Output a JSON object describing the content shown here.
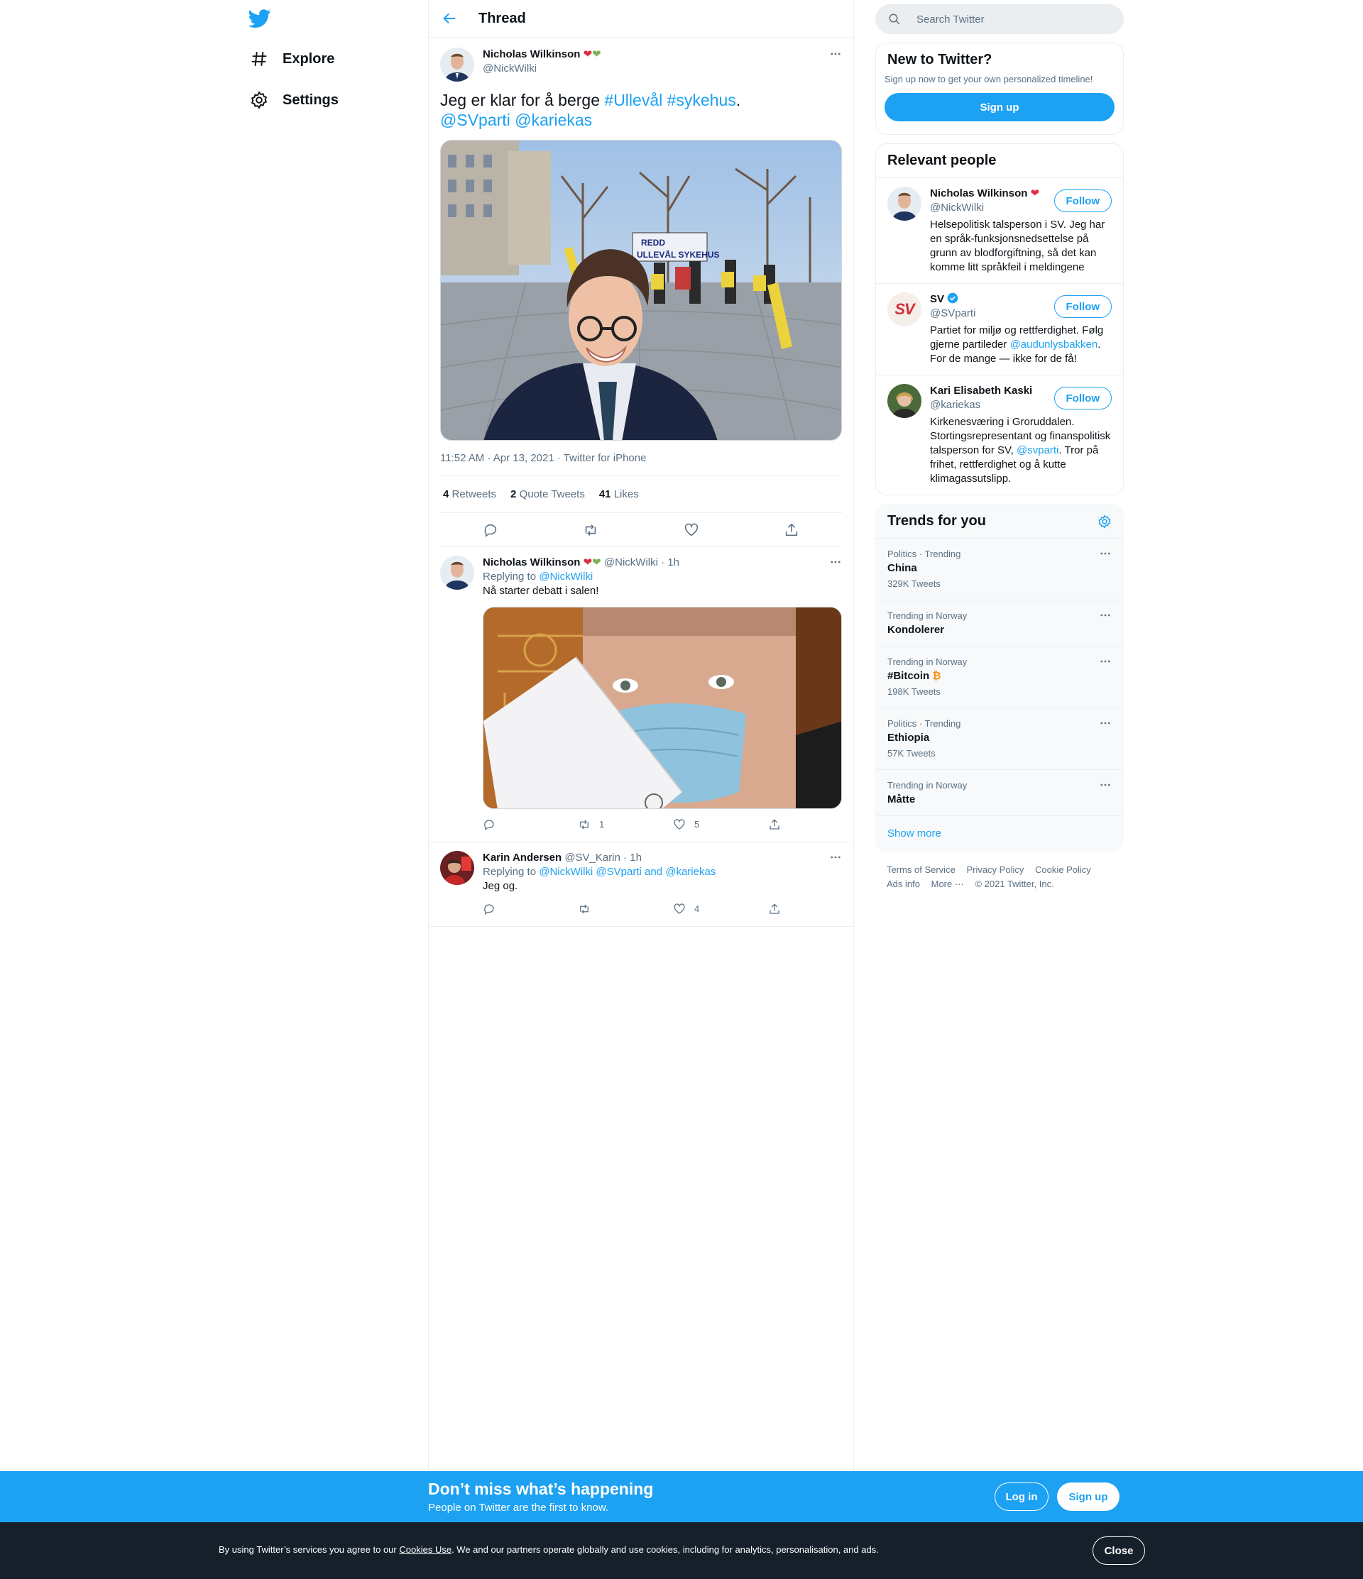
{
  "nav": {
    "explore": "Explore",
    "settings": "Settings"
  },
  "header": {
    "title": "Thread"
  },
  "main_tweet": {
    "name": "Nicholas Wilkinson",
    "handle": "@NickWilki",
    "text_1": "Jeg er klar for å berge ",
    "hashtag_1": "#Ullevål",
    "hashtag_2": "#sykehus",
    "text_2": ".",
    "mention_1": "@SVparti",
    "mention_2": "@kariekas",
    "image_text": "REDD ULLEVÅL SYKEHUS",
    "meta": "11:52 AM · Apr 13, 2021 · Twitter for iPhone",
    "retweets": "4",
    "retweets_label": "Retweets",
    "quotes": "2",
    "quotes_label": "Quote Tweets",
    "likes": "41",
    "likes_label": "Likes"
  },
  "replies": [
    {
      "name": "Nicholas Wilkinson",
      "handle": "@NickWilki · 1h",
      "replying_prefix": "Replying to ",
      "replying_to": "@NickWilki",
      "text": "Nå starter debatt i salen!",
      "retweets": "1",
      "likes": "5"
    },
    {
      "name": "Karin Andersen",
      "handle": "@SV_Karin · 1h",
      "replying_prefix": "Replying to ",
      "replying_to": "@NickWilki @SVparti and @kariekas",
      "text": "Jeg og.",
      "likes": "4"
    }
  ],
  "search": {
    "placeholder": "Search Twitter"
  },
  "new_to_twitter": {
    "title": "New to Twitter?",
    "subtitle": "Sign up now to get your own personalized timeline!",
    "button": "Sign up"
  },
  "relevant_people": {
    "title": "Relevant people",
    "follow": "Follow",
    "people": [
      {
        "name": "Nicholas Wilkinson",
        "handle": "@NickWilki",
        "bio": "Helsepolitisk talsperson i SV. Jeg har en språk-funksjonsnedsettelse på grunn av blodforgiftning, så det kan komme litt språkfeil i meldingene"
      },
      {
        "name": "SV",
        "handle": "@SVparti",
        "bio_1": "Partiet for miljø og rettferdighet. Følg gjerne partileder ",
        "bio_link": "@audunlysbakken",
        "bio_2": ". For de mange — ikke for de få!",
        "avatar_text": "SV"
      },
      {
        "name": "Kari Elisabeth Kaski",
        "handle": "@kariekas",
        "bio_1": "Kirkenesværing i Groruddalen. Stortingsrepresentant og finanspolitisk talsperson for SV, ",
        "bio_link": "@svparti",
        "bio_2": ". Tror på frihet, rettferdighet og å kutte klimagassutslipp."
      }
    ]
  },
  "trends": {
    "title": "Trends for you",
    "items": [
      {
        "context": "Politics · Trending",
        "name": "China",
        "count": "329K Tweets"
      },
      {
        "context": "Trending in Norway",
        "name": "Kondolerer",
        "count": ""
      },
      {
        "context": "Trending in Norway",
        "name": "#Bitcoin",
        "count": "198K Tweets"
      },
      {
        "context": "Politics · Trending",
        "name": "Ethiopia",
        "count": "57K Tweets"
      },
      {
        "context": "Trending in Norway",
        "name": "Måtte",
        "count": ""
      }
    ],
    "show_more": "Show more"
  },
  "footer": {
    "terms": "Terms of Service",
    "privacy": "Privacy Policy",
    "cookie": "Cookie Policy",
    "ads": "Ads info",
    "more": "More ···",
    "copyright": "© 2021 Twitter, Inc."
  },
  "bottom_bar": {
    "title": "Don’t miss what’s happening",
    "subtitle": "People on Twitter are the first to know.",
    "login": "Log in",
    "signup": "Sign up"
  },
  "cookie_bar": {
    "text_1": "By using Twitter’s services you agree to our ",
    "link": "Cookies Use",
    "text_2": ". We and our partners operate globally and use cookies, including for analytics, personalisation, and ads.",
    "close": "Close"
  },
  "colors": {
    "accent": "#1da1f2",
    "text": "#0f1419",
    "muted": "#5b7083",
    "border": "#ebeef0",
    "cookie_bg": "#15202b"
  }
}
